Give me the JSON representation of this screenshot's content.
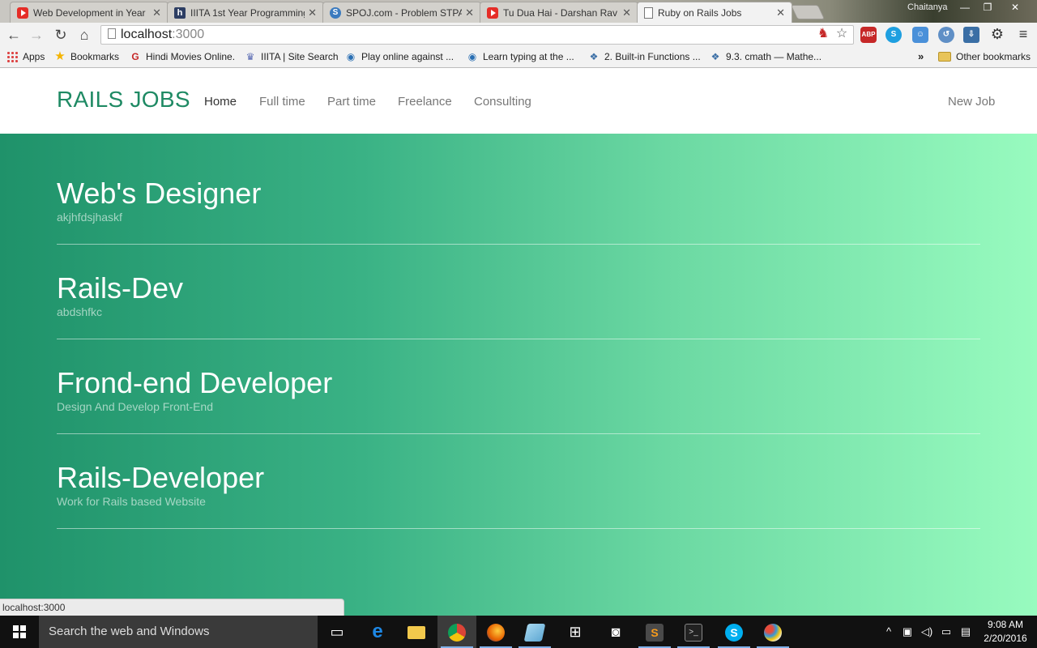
{
  "browser": {
    "tabs": [
      {
        "title": "Web Development in Year",
        "icon": "youtube-icon"
      },
      {
        "title": "IIITA 1st Year Programming",
        "icon": "hackerearth-icon"
      },
      {
        "title": "SPOJ.com - Problem STPA",
        "icon": "spoj-icon"
      },
      {
        "title": "Tu Dua Hai - Darshan Rav",
        "icon": "youtube-icon"
      },
      {
        "title": "Ruby on Rails Jobs",
        "icon": "page-icon",
        "active": true
      }
    ],
    "profile_name": "Chaitanya",
    "url_host": "localhost",
    "url_port": ":3000",
    "bookmarks": [
      {
        "label": "Apps",
        "icon": "apps-icon"
      },
      {
        "label": "Bookmarks",
        "icon": "star-icon"
      },
      {
        "label": "Hindi Movies Online.",
        "icon": "movie-icon"
      },
      {
        "label": "IIITA | Site Search",
        "icon": "iiita-icon"
      },
      {
        "label": "Play online against ...",
        "icon": "chess-icon"
      },
      {
        "label": "Learn typing at the ...",
        "icon": "typing-icon"
      },
      {
        "label": "2. Built-in Functions ...",
        "icon": "python-icon"
      },
      {
        "label": "9.3. cmath — Mathe...",
        "icon": "python-icon"
      }
    ],
    "overflow": "»",
    "other_bookmarks": "Other bookmarks",
    "status_url": "localhost:3000"
  },
  "site": {
    "brand": "RAILS JOBS",
    "nav": [
      "Home",
      "Full time",
      "Part time",
      "Freelance",
      "Consulting"
    ],
    "new_job": "New Job",
    "accent": "#1f8a64",
    "jobs": [
      {
        "title": "Web's Designer",
        "description": "akjhfdsjhaskf"
      },
      {
        "title": "Rails-Dev",
        "description": "abdshfkc"
      },
      {
        "title": "Frond-end Developer",
        "description": "Design And Develop Front-End"
      },
      {
        "title": "Rails-Developer",
        "description": "Work for Rails based Website"
      }
    ]
  },
  "taskbar": {
    "search_placeholder": "Search the web and Windows",
    "time": "9:08 AM",
    "date": "2/20/2016",
    "apps": [
      "task-view-icon",
      "edge-icon",
      "file-explorer-icon",
      "chrome-icon",
      "firefox-icon",
      "notepad-icon",
      "store-icon",
      "camera-icon",
      "sublime-icon",
      "terminal-icon",
      "skype-icon",
      "paint-icon"
    ]
  }
}
